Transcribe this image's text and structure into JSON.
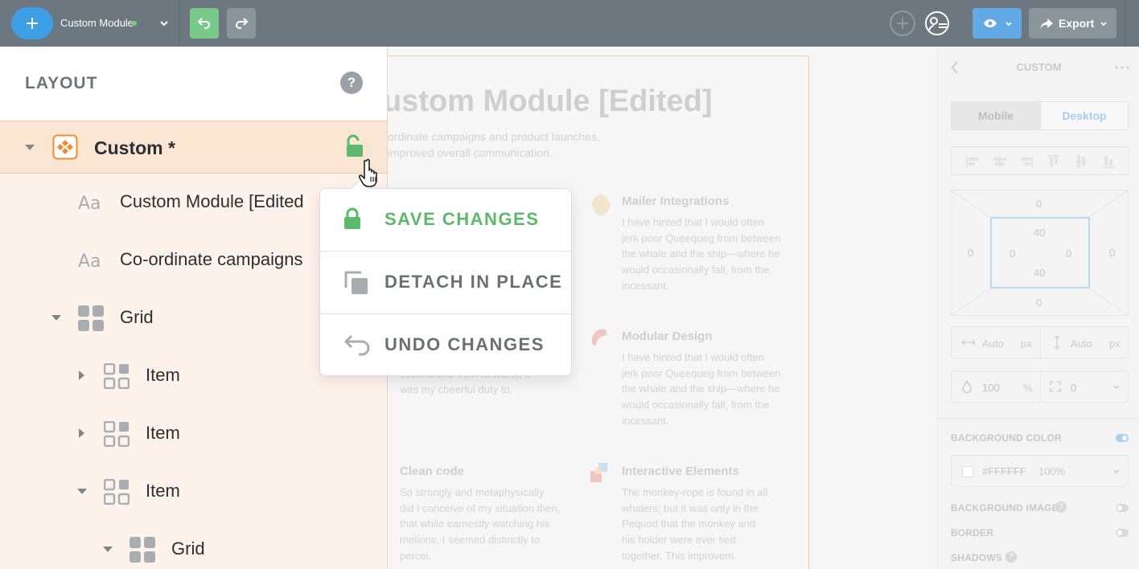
{
  "toolbar": {
    "module_name": "Custom Module",
    "export_label": "Export",
    "colors": {
      "bg": "#6c7780",
      "add": "#3f9fe6",
      "undo": "#79c98a",
      "eye": "#62a9e6",
      "status_dot": "#6fd36f"
    }
  },
  "layout_panel": {
    "title": "LAYOUT",
    "help": "?",
    "tree": [
      {
        "label": "Custom *",
        "icon": "custom-module-icon",
        "selected": true,
        "expanded": true
      },
      {
        "label": "Custom Module [Edited",
        "icon": "text-icon"
      },
      {
        "label": "Co-ordinate campaigns",
        "icon": "text-icon"
      },
      {
        "label": "Grid",
        "icon": "grid-icon",
        "expanded": true
      },
      {
        "label": "Item",
        "icon": "grid-icon",
        "expanded": false
      },
      {
        "label": "Item",
        "icon": "grid-icon",
        "expanded": false
      },
      {
        "label": "Item",
        "icon": "grid-icon",
        "expanded": true
      },
      {
        "label": "Grid",
        "icon": "grid-icon",
        "expanded": true
      }
    ]
  },
  "popup": {
    "items": [
      {
        "label": "SAVE CHANGES",
        "icon": "lock-icon",
        "color": "#5cb96b"
      },
      {
        "label": "DETACH IN PLACE",
        "icon": "copy-icon",
        "color": "#6b7075"
      },
      {
        "label": "UNDO CHANGES",
        "icon": "undo-icon",
        "color": "#6b7075"
      }
    ]
  },
  "canvas": {
    "title": "ustom Module [Edited]",
    "subtitle_line1": "ordinate campaigns and product launches,",
    "subtitle_line2": "improved overall communication.",
    "features": [
      {
        "title": "Mailer Integrations",
        "text": "I have hinted that I would often jerk poor Queequeg from between the whale and the ship—where he would occasionally fall, from the incessant."
      },
      {
        "title": "Modular Design",
        "text": "I have hinted that I would often jerk poor Queequeg from between the whale and the ship—where he would occasionally fall, from the incessant."
      },
      {
        "title": "",
        "text": "the bow-oar in his boat (the second one from forward), it was my cheerful duty to."
      },
      {
        "title": "Clean code",
        "text": "So strongly and metaphysically did I conceive of my situation then, that while earnestly watching his motions, I seemed distinctly to percei."
      },
      {
        "title": "Interactive Elements",
        "text": "The monkey-rope is found in all whalers; but it was only in the Pequod that the monkey and his holder were ever tied together. This improvem."
      }
    ]
  },
  "right_panel": {
    "title": "CUSTOM",
    "tabs": [
      "Mobile",
      "Desktop"
    ],
    "active_tab": "Desktop",
    "box_model": {
      "margin_top": "0",
      "margin_right": "0",
      "margin_bottom": "0",
      "margin_left": "0",
      "padding_top": "40",
      "padding_right": "0",
      "padding_bottom": "40",
      "padding_left": "0"
    },
    "width": {
      "value": "Auto",
      "unit": "px"
    },
    "height": {
      "value": "Auto",
      "unit": "px"
    },
    "opacity": {
      "value": "100",
      "unit": "%"
    },
    "radius": {
      "value": "0"
    },
    "background_color_label": "BACKGROUND COLOR",
    "background_color": {
      "hex": "#FFFFFF",
      "alpha": "100%"
    },
    "background_image_label": "BACKGROUND IMAGE",
    "border_label": "BORDER",
    "shadows_label": "SHADOWS"
  }
}
